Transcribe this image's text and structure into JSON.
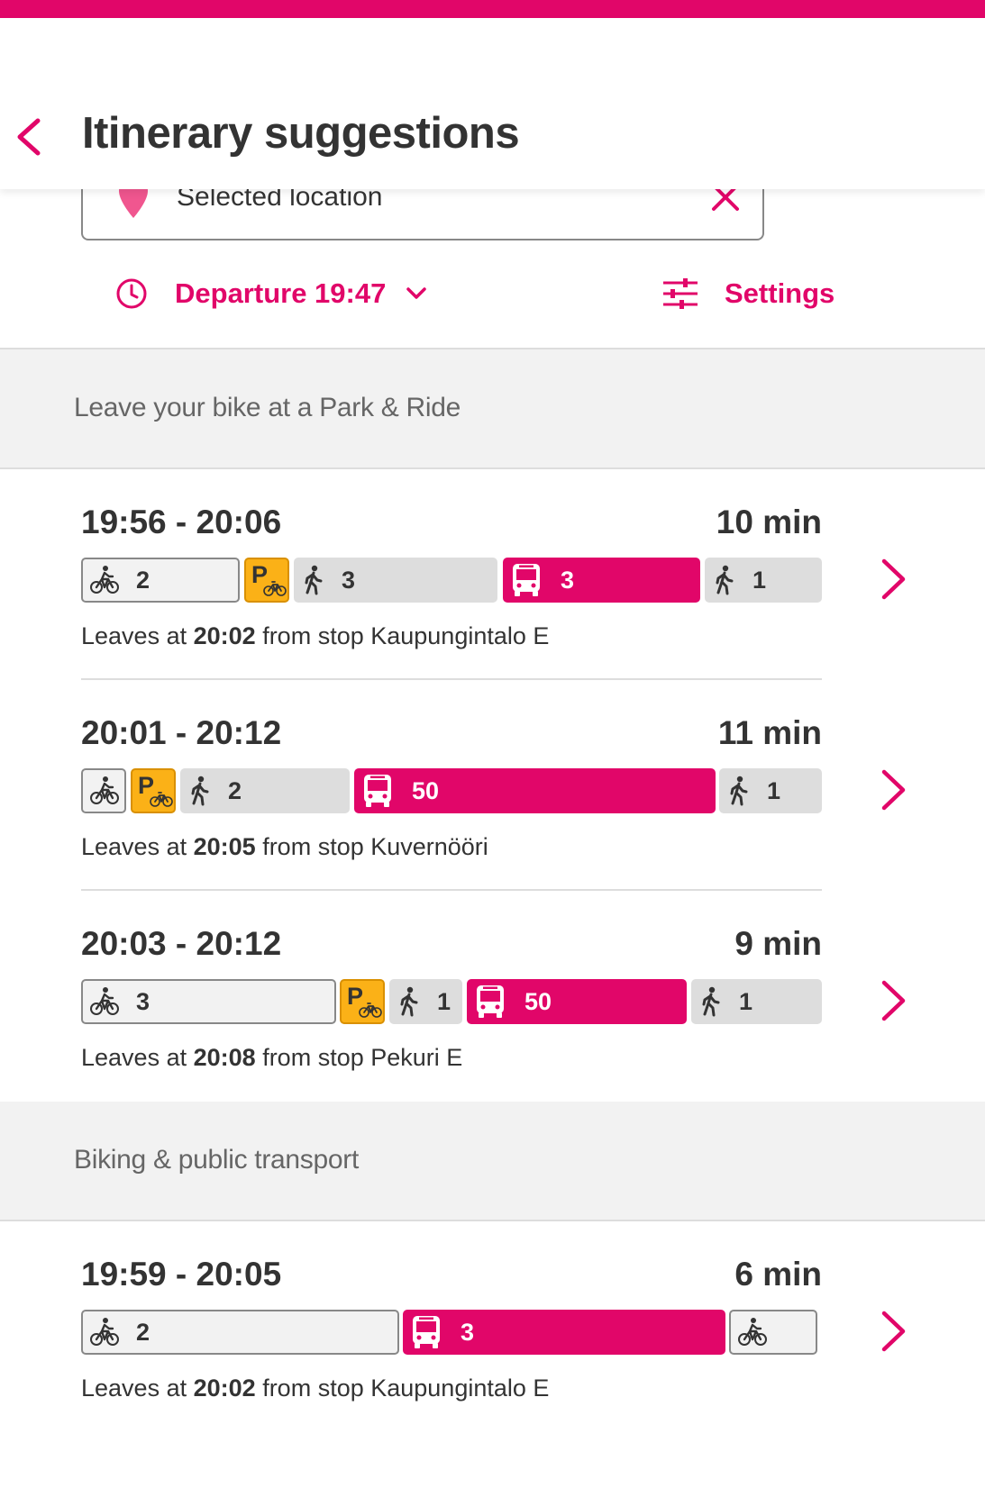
{
  "colors": {
    "accent": "#e10669",
    "park": "#fbb117",
    "walk_bg": "#dddddd",
    "section_bg": "#f2f2f2"
  },
  "header": {
    "title": "Itinerary suggestions",
    "back_icon": "chevron-left-icon"
  },
  "search": {
    "value": "Selected location",
    "pin_icon": "location-pin-icon",
    "clear_icon": "close-icon"
  },
  "toolbar": {
    "departure_label": "Departure 19:47",
    "departure_icon": "clock-icon",
    "dropdown_icon": "chevron-down-icon",
    "settings_label": "Settings",
    "settings_icon": "sliders-icon"
  },
  "sections": [
    {
      "title": "Leave your bike at a Park & Ride",
      "itineraries": [
        {
          "time": "19:56 - 20:06",
          "duration": "10 min",
          "legs": [
            {
              "mode": "bike",
              "label": "2"
            },
            {
              "mode": "park",
              "label": ""
            },
            {
              "mode": "walk",
              "label": "3"
            },
            {
              "mode": "bus",
              "label": "3"
            },
            {
              "mode": "walk",
              "label": "1"
            }
          ],
          "desc_prefix": "Leaves at",
          "desc_time": "20:02",
          "desc_suffix": "from stop Kaupungintalo E"
        },
        {
          "time": "20:01 - 20:12",
          "duration": "11 min",
          "legs": [
            {
              "mode": "bike",
              "label": ""
            },
            {
              "mode": "park",
              "label": ""
            },
            {
              "mode": "walk",
              "label": "2"
            },
            {
              "mode": "bus",
              "label": "50"
            },
            {
              "mode": "walk",
              "label": "1"
            }
          ],
          "desc_prefix": "Leaves at",
          "desc_time": "20:05",
          "desc_suffix": "from stop Kuvernööri"
        },
        {
          "time": "20:03 - 20:12",
          "duration": "9 min",
          "legs": [
            {
              "mode": "bike",
              "label": "3"
            },
            {
              "mode": "park",
              "label": ""
            },
            {
              "mode": "walk",
              "label": "1"
            },
            {
              "mode": "bus",
              "label": "50"
            },
            {
              "mode": "walk",
              "label": "1"
            }
          ],
          "desc_prefix": "Leaves at",
          "desc_time": "20:08",
          "desc_suffix": "from stop Pekuri E"
        }
      ]
    },
    {
      "title": "Biking & public transport",
      "itineraries": [
        {
          "time": "19:59 - 20:05",
          "duration": "6 min",
          "legs": [
            {
              "mode": "bike",
              "label": "2"
            },
            {
              "mode": "bus",
              "label": "3"
            },
            {
              "mode": "bike",
              "label": ""
            }
          ],
          "desc_prefix": "Leaves at",
          "desc_time": "20:02",
          "desc_suffix": "from stop Kaupungintalo E"
        }
      ]
    }
  ]
}
